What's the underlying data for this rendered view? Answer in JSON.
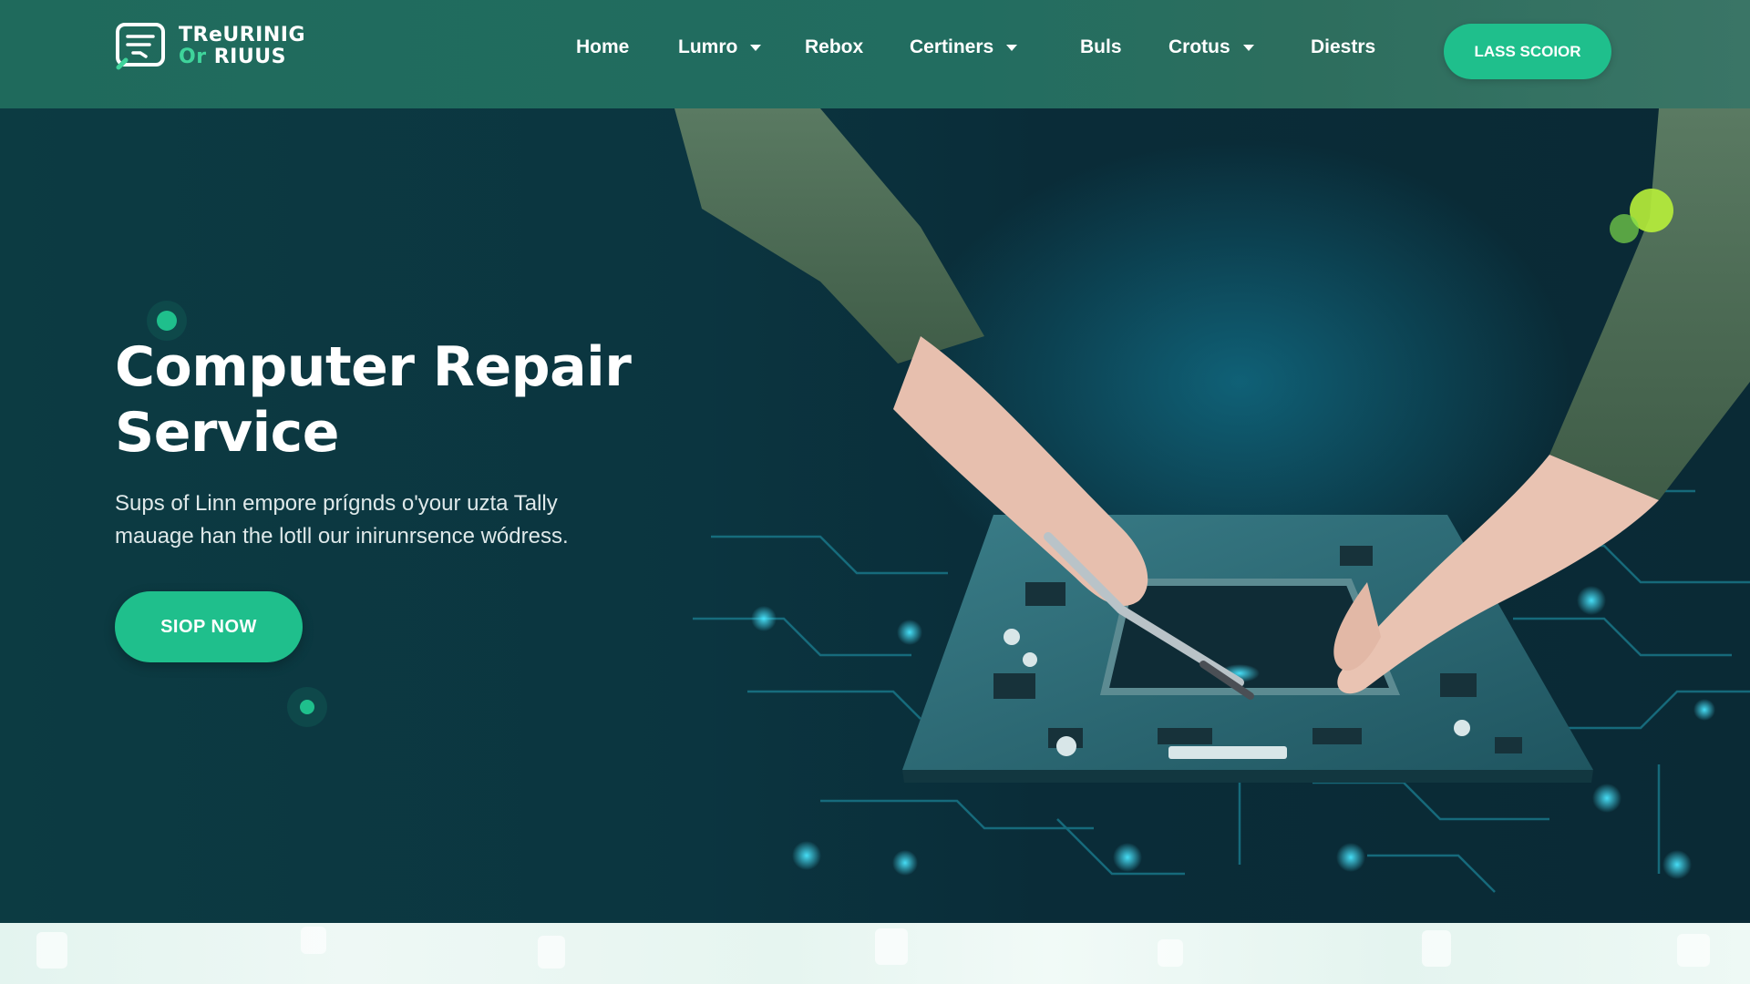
{
  "brand": {
    "line1": "TReURINIG",
    "line2_accent": "Or",
    "line2_rest": "RIUUS"
  },
  "nav": {
    "items": [
      {
        "label": "Home",
        "dropdown": false
      },
      {
        "label": "Lumro",
        "dropdown": true
      },
      {
        "label": "Rebox",
        "dropdown": false
      },
      {
        "label": "Certiners",
        "dropdown": true
      },
      {
        "label": "Buls",
        "dropdown": false
      },
      {
        "label": "Crotus",
        "dropdown": true
      },
      {
        "label": "Diestrs",
        "dropdown": false
      }
    ],
    "cta_label": "LASS SCOIOR"
  },
  "hero": {
    "title_line1": "Computer Repair",
    "title_line2": "Service",
    "subtitle_line1": "Sups of Linn empore prígnds o'your uzta Tally",
    "subtitle_line2": "mauage han the lotll our inirunrsence wódress.",
    "cta_label": "SIOP NOW"
  },
  "colors": {
    "accent": "#1fbf8c",
    "header_bg": "#226d60",
    "hero_bg": "#0b3540",
    "text_light": "#ffffff"
  },
  "icons": {
    "logo": "monitor-chat-icon",
    "dropdown": "chevron-down-icon"
  }
}
